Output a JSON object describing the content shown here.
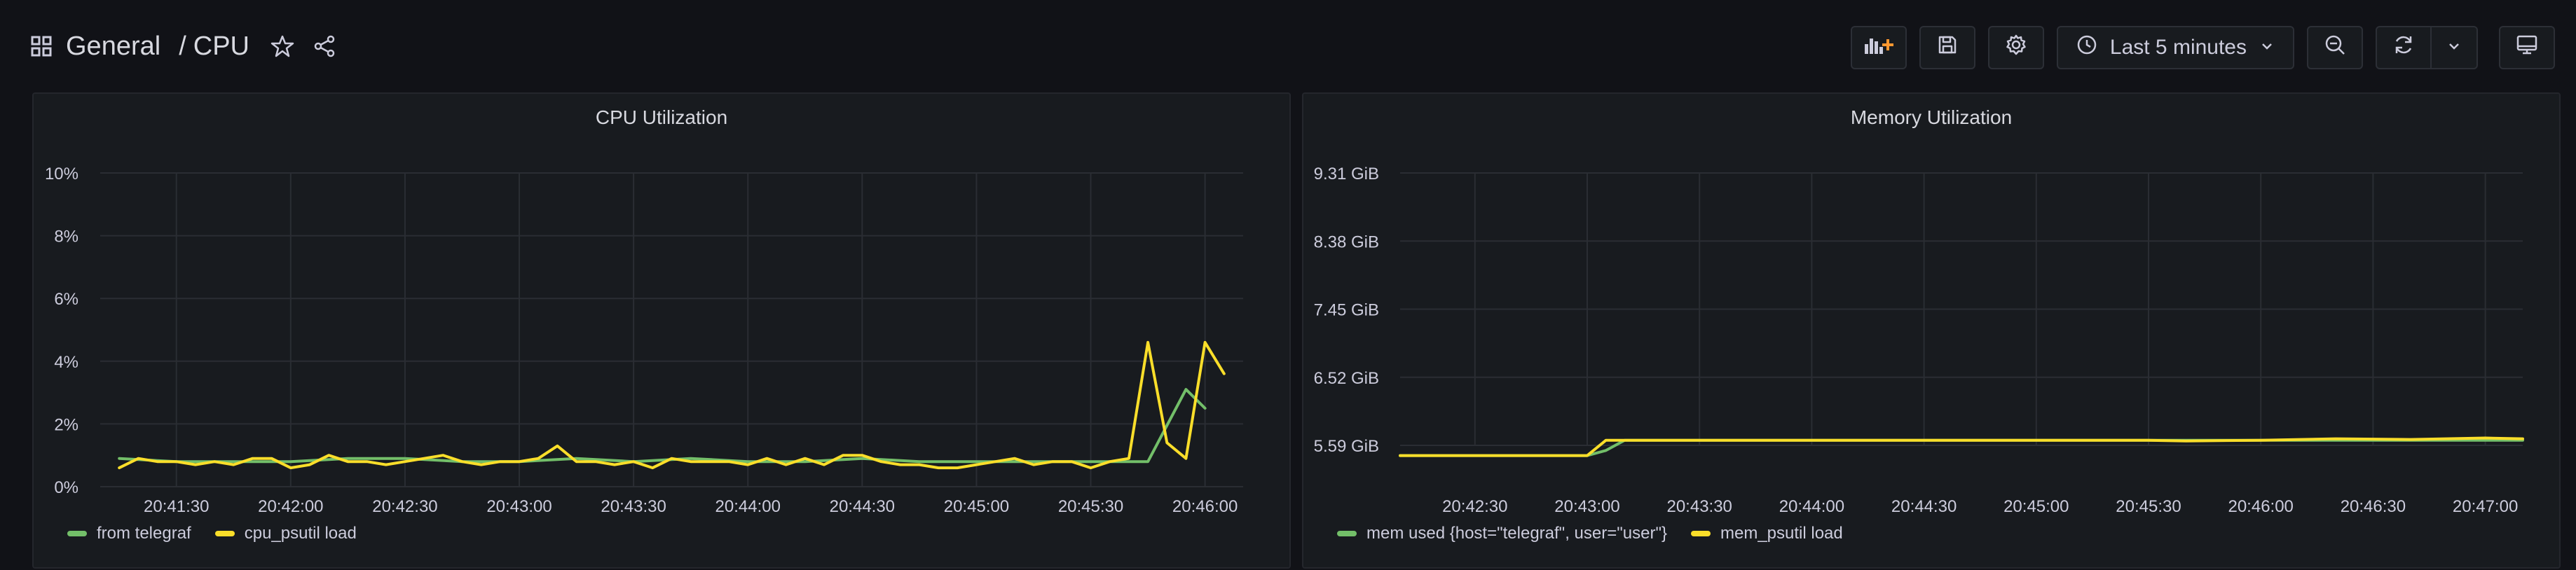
{
  "header": {
    "breadcrumb_folder": "General",
    "breadcrumb_separator": "/",
    "breadcrumb_dashboard": "CPU",
    "time_range_label": "Last 5 minutes"
  },
  "icons": {
    "dashboards": "grid-icon",
    "star": "star-icon",
    "share": "share-icon",
    "add_panel": "add-panel-icon",
    "save": "save-icon",
    "settings": "gear-icon",
    "clock": "clock-icon",
    "zoom_out": "zoom-out-icon",
    "refresh": "refresh-icon",
    "tv": "tv-mode-icon"
  },
  "colors": {
    "green": "#73bf69",
    "yellow": "#fade2a",
    "accent": "#ff9830"
  },
  "chart_data": [
    {
      "type": "line",
      "title": "CPU Utilization",
      "xlabel": "",
      "ylabel": "",
      "x_ticks": [
        "20:41:30",
        "20:42:00",
        "20:42:30",
        "20:43:00",
        "20:43:30",
        "20:44:00",
        "20:44:30",
        "20:45:00",
        "20:45:30",
        "20:46:00"
      ],
      "y_ticks": [
        "0%",
        "2%",
        "4%",
        "6%",
        "8%",
        "10%"
      ],
      "xlim": [
        "20:41:10",
        "20:46:10"
      ],
      "ylim": [
        0,
        10
      ],
      "grid": true,
      "legend": "bottom-left",
      "series": [
        {
          "name": "from telegraf",
          "color": "#73bf69",
          "x": [
            "20:41:15",
            "20:41:30",
            "20:41:45",
            "20:42:00",
            "20:42:15",
            "20:42:30",
            "20:42:45",
            "20:43:00",
            "20:43:15",
            "20:43:30",
            "20:43:45",
            "20:44:00",
            "20:44:15",
            "20:44:30",
            "20:44:45",
            "20:45:00",
            "20:45:15",
            "20:45:30",
            "20:45:45",
            "20:45:55",
            "20:46:00"
          ],
          "y": [
            0.9,
            0.8,
            0.8,
            0.8,
            0.9,
            0.9,
            0.8,
            0.8,
            0.9,
            0.8,
            0.9,
            0.8,
            0.8,
            0.9,
            0.8,
            0.8,
            0.8,
            0.8,
            0.8,
            3.1,
            2.5
          ]
        },
        {
          "name": "cpu_psutil load",
          "color": "#fade2a",
          "x": [
            "20:41:15",
            "20:41:20",
            "20:41:25",
            "20:41:30",
            "20:41:35",
            "20:41:40",
            "20:41:45",
            "20:41:50",
            "20:41:55",
            "20:42:00",
            "20:42:05",
            "20:42:10",
            "20:42:15",
            "20:42:20",
            "20:42:25",
            "20:42:30",
            "20:42:35",
            "20:42:40",
            "20:42:45",
            "20:42:50",
            "20:42:55",
            "20:43:00",
            "20:43:05",
            "20:43:10",
            "20:43:15",
            "20:43:20",
            "20:43:25",
            "20:43:30",
            "20:43:35",
            "20:43:40",
            "20:43:45",
            "20:43:50",
            "20:43:55",
            "20:44:00",
            "20:44:05",
            "20:44:10",
            "20:44:15",
            "20:44:20",
            "20:44:25",
            "20:44:30",
            "20:44:35",
            "20:44:40",
            "20:44:45",
            "20:44:50",
            "20:44:55",
            "20:45:00",
            "20:45:05",
            "20:45:10",
            "20:45:15",
            "20:45:20",
            "20:45:25",
            "20:45:30",
            "20:45:35",
            "20:45:40",
            "20:45:45",
            "20:45:50",
            "20:45:55",
            "20:46:00",
            "20:46:05"
          ],
          "y": [
            0.6,
            0.9,
            0.8,
            0.8,
            0.7,
            0.8,
            0.7,
            0.9,
            0.9,
            0.6,
            0.7,
            1.0,
            0.8,
            0.8,
            0.7,
            0.8,
            0.9,
            1.0,
            0.8,
            0.7,
            0.8,
            0.8,
            0.9,
            1.3,
            0.8,
            0.8,
            0.7,
            0.8,
            0.6,
            0.9,
            0.8,
            0.8,
            0.8,
            0.7,
            0.9,
            0.7,
            0.9,
            0.7,
            1.0,
            1.0,
            0.8,
            0.7,
            0.7,
            0.6,
            0.6,
            0.7,
            0.8,
            0.9,
            0.7,
            0.8,
            0.8,
            0.6,
            0.8,
            0.9,
            4.6,
            1.4,
            0.9,
            4.6,
            3.6
          ]
        }
      ]
    },
    {
      "type": "line",
      "title": "Memory Utilization",
      "xlabel": "",
      "ylabel": "",
      "x_ticks": [
        "20:42:30",
        "20:43:00",
        "20:43:30",
        "20:44:00",
        "20:44:30",
        "20:45:00",
        "20:45:30",
        "20:46:00",
        "20:46:30",
        "20:47:00"
      ],
      "y_ticks": [
        "5.59 GiB",
        "6.52 GiB",
        "7.45 GiB",
        "8.38 GiB",
        "9.31 GiB"
      ],
      "xlim": [
        "20:42:10",
        "20:47:10"
      ],
      "ylim": [
        5.59,
        9.31
      ],
      "grid": true,
      "legend": "bottom-left",
      "series": [
        {
          "name": "mem used {host=\"telegraf\", user=\"user\"}",
          "color": "#73bf69",
          "x": [
            "20:42:10",
            "20:43:00",
            "20:43:05",
            "20:43:10",
            "20:44:00",
            "20:45:00",
            "20:45:30",
            "20:46:00",
            "20:46:30",
            "20:47:00",
            "20:47:10"
          ],
          "y": [
            5.45,
            5.45,
            5.52,
            5.66,
            5.66,
            5.66,
            5.66,
            5.66,
            5.66,
            5.66,
            5.66
          ]
        },
        {
          "name": "mem_psutil load",
          "color": "#fade2a",
          "x": [
            "20:42:10",
            "20:43:00",
            "20:43:05",
            "20:43:10",
            "20:43:30",
            "20:44:00",
            "20:44:30",
            "20:45:00",
            "20:45:30",
            "20:45:40",
            "20:46:00",
            "20:46:20",
            "20:46:40",
            "20:47:00",
            "20:47:10"
          ],
          "y": [
            5.45,
            5.45,
            5.66,
            5.66,
            5.66,
            5.66,
            5.66,
            5.66,
            5.66,
            5.65,
            5.66,
            5.68,
            5.67,
            5.69,
            5.68
          ]
        }
      ]
    }
  ]
}
